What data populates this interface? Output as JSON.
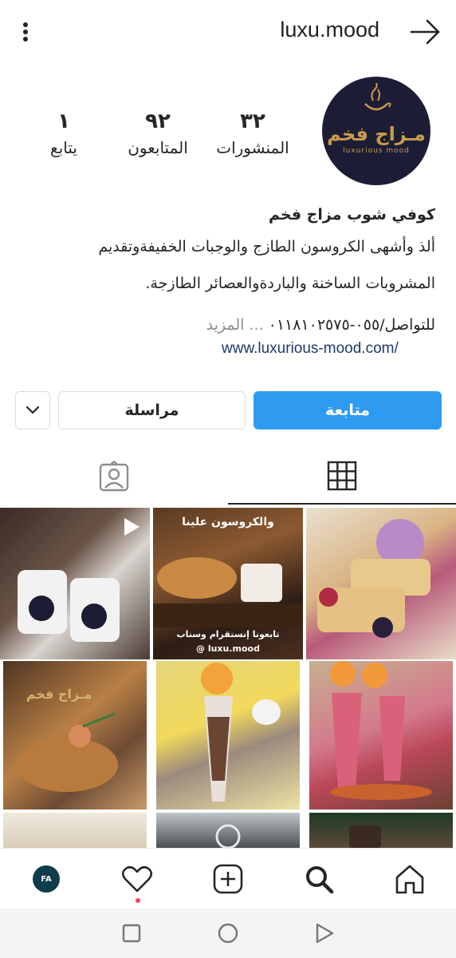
{
  "header": {
    "username": "luxu.mood"
  },
  "profile": {
    "avatar_text_ar": "مـزاج فخم",
    "avatar_text_en": "luxurious mood",
    "stats": {
      "posts_count": "٣٢",
      "posts_label": "المنشورات",
      "followers_count": "٩٢",
      "followers_label": "المتابعون",
      "following_count": "١",
      "following_label": "يتابع"
    }
  },
  "bio": {
    "name": "كوفي شوب مزاج فخم",
    "line1": "ألذ وأشهى الكروسون الطازج والوجبات الخفيفةوتقديم",
    "line2": "المشروبات الساخنة والباردةوالعصائر الطازجة.",
    "line3": "للتواصل/٠٥٥-٠١١٨١٠٢٥٧٥",
    "more": "... المزيد",
    "link": "www.luxurious-mood.com/"
  },
  "actions": {
    "follow_label": "متابعة",
    "message_label": "مراسلة"
  },
  "posts": {
    "tile2_text_top": "والكروسون علينا",
    "tile2_text_bottom": "تابعونا إنستقرام وسناب",
    "tile2_handle": "@ luxu.mood",
    "tile4_text": "مـزاج فخم"
  },
  "colors": {
    "follow_button": "#2f9bf0",
    "notification_dot": "#ed4956",
    "avatar_bg": "#1c1d35",
    "avatar_gold": "#c79b4c",
    "link": "#1b3a6b"
  },
  "icons": {
    "menu": "more-vertical-icon",
    "back": "arrow-right-icon",
    "tagged": "tagged-person-icon",
    "grid": "grid-icon",
    "activity": "heart-icon",
    "new_post": "plus-square-icon",
    "search": "search-icon",
    "home": "home-icon"
  },
  "nav": {
    "profile_avatar_text": "FA"
  }
}
